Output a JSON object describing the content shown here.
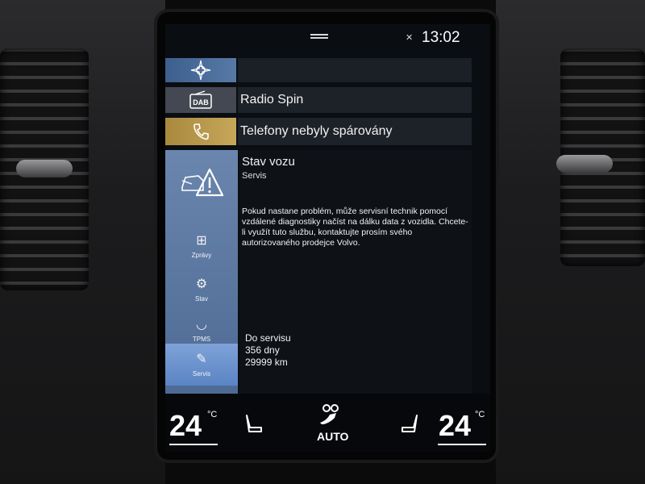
{
  "status": {
    "time": "13:02",
    "mute_icon": "speaker-muted-icon"
  },
  "tiles": {
    "navigation": {
      "icon": "compass-icon",
      "accent": "#4f6f9c"
    },
    "radio": {
      "icon": "dab-icon",
      "badge": "DAB",
      "label": "Radio Spin"
    },
    "phone": {
      "icon": "phone-icon",
      "label": "Telefony nebyly spárovány",
      "accent": "#b89a4c"
    }
  },
  "car_status": {
    "icon": "car-warning-icon",
    "title": "Stav vozu",
    "subtitle": "Servis",
    "message": "Pokud nastane problém, může servisní technik pomocí vzdálené diagnostiky načíst na dálku data z vozidla. Chcete-li využít tuto službu, kontaktujte prosím svého autorizovaného prodejce Volvo.",
    "side_items": [
      {
        "label": "Zprávy",
        "icon": "messages-icon"
      },
      {
        "label": "Stav",
        "icon": "status-icon"
      },
      {
        "label": "TPMS",
        "icon": "tpms-icon"
      },
      {
        "label": "Servis",
        "icon": "service-icon"
      }
    ],
    "service": {
      "heading": "Do servisu",
      "days": "356 dny",
      "km": "29999 km"
    }
  },
  "climate": {
    "left_temp": "24",
    "right_temp": "24",
    "unit": "°C",
    "mode": "AUTO"
  }
}
